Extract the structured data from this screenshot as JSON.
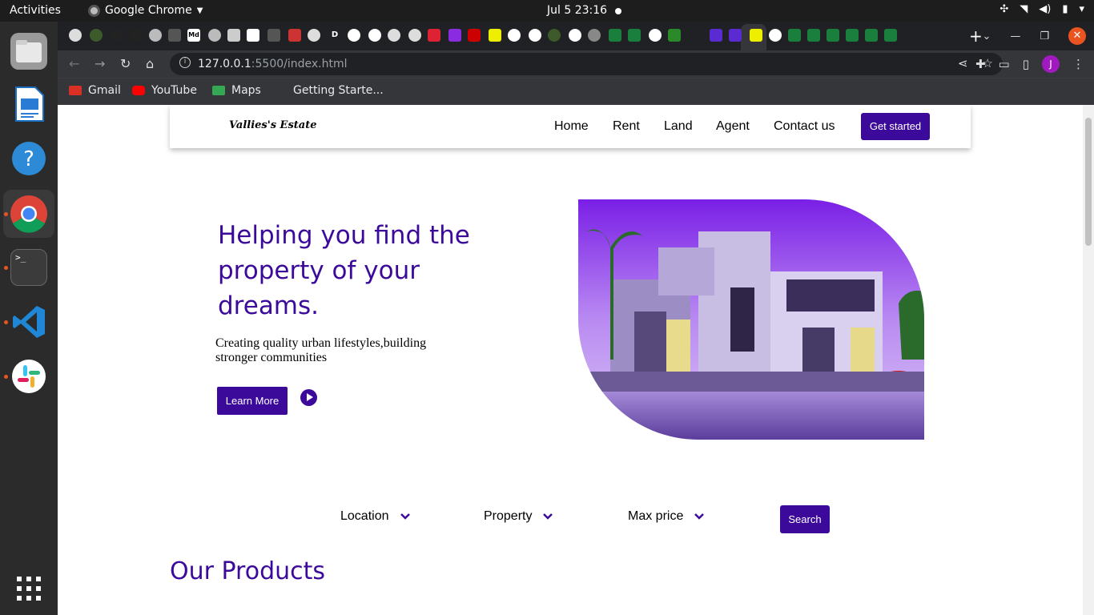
{
  "system": {
    "activities": "Activities",
    "app_name": "Google Chrome",
    "clock": "Jul 5  23:16"
  },
  "browser": {
    "url_host": "127.0.0.1",
    "url_rest": ":5500/index.html",
    "avatar_letter": "J",
    "tab_letters": [
      "D",
      "Md"
    ],
    "bookmarks": [
      "Gmail",
      "YouTube",
      "Maps",
      "Getting Starte..."
    ]
  },
  "site": {
    "logo": "Vallies's Estate",
    "nav": [
      "Home",
      "Rent",
      "Land",
      "Agent",
      "Contact us"
    ],
    "cta": "Get started",
    "hero": {
      "headline_lines": [
        "Helping you find the",
        "property of your",
        "dreams."
      ],
      "subtext_lines": [
        "Creating quality urban lifestyles,building",
        "stronger communities"
      ],
      "learn_more": "Learn More"
    },
    "filters": [
      "Location",
      "Property",
      "Max price"
    ],
    "search": "Search",
    "products_heading": "Our Products"
  },
  "colors": {
    "brand": "#3c0a9a",
    "hero_sky": "#8a3cf0"
  }
}
